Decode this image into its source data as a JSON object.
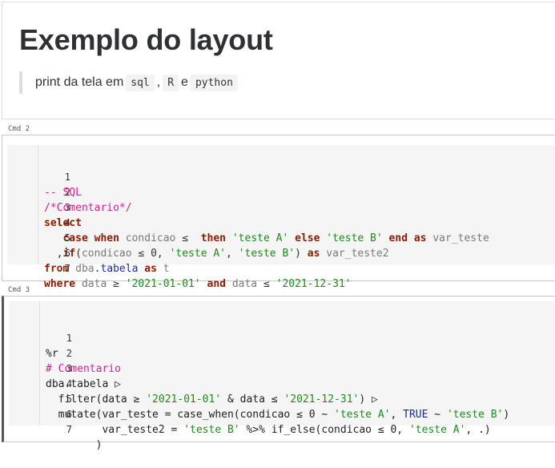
{
  "markdown_cell": {
    "title": "Exemplo do layout",
    "quote_prefix": "print da tela em",
    "code_sql": "sql",
    "sep1": ",",
    "code_r": "R",
    "sep2": "e",
    "code_python": "python"
  },
  "cells": [
    {
      "label": "Cmd 2",
      "language": "SQL",
      "lines": [
        {
          "n": "1",
          "text": "-- SQL"
        },
        {
          "n": "2",
          "text": "/*Comentario*/"
        },
        {
          "n": "3",
          "text": "select"
        },
        {
          "n": "4",
          "text": "   case when condicao ≤  then 'teste A' else 'teste B' end as var_teste"
        },
        {
          "n": "5",
          "text": "  ,if(condicao ≤ 0, 'teste A', 'teste B') as var_teste2"
        },
        {
          "n": "6",
          "text": "from dba.tabela as t"
        },
        {
          "n": "7",
          "text": "where data ≥ '2021-01-01' and data ≤ '2021-12-31'"
        }
      ]
    },
    {
      "label": "Cmd 3",
      "language": "R",
      "lines": [
        {
          "n": "1",
          "text": "%r"
        },
        {
          "n": "2",
          "text": "# Comentario"
        },
        {
          "n": "3",
          "text": "dba.tabela ▷"
        },
        {
          "n": "4",
          "text": "  filter(data ≥ '2021-01-01' & data ≤ '2021-12-31') ▷"
        },
        {
          "n": "5",
          "text": "  mutate(var_teste = case_when(condicao ≤ 0 ~ 'teste A', TRUE ~ 'teste B')"
        },
        {
          "n": "6",
          "text": "         var_teste2 = 'teste B' %>% if_else(condicao ≤ 0, 'teste A', .)"
        },
        {
          "n": "7",
          "text": "        )"
        }
      ]
    }
  ],
  "colors": {
    "keyword": "#8f1a00",
    "string": "#1f8a1f",
    "comment": "#d7208f",
    "identifier_grey": "#7a7a7a",
    "identifier_blue": "#1a2c8f",
    "code_background": "#f5f5f5"
  }
}
